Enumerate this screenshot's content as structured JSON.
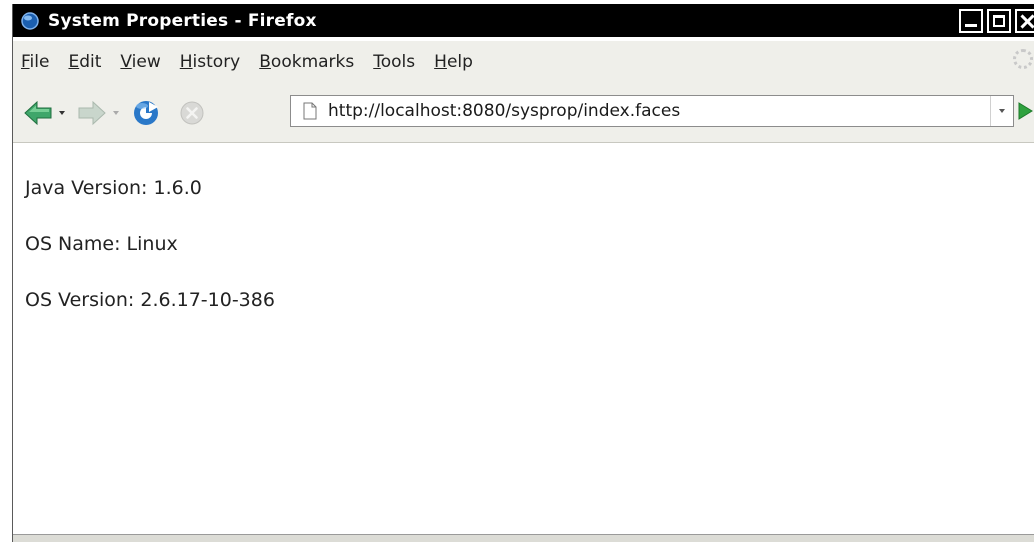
{
  "window": {
    "title": "System Properties - Firefox"
  },
  "menubar": {
    "items": [
      {
        "label": "File"
      },
      {
        "label": "Edit"
      },
      {
        "label": "View"
      },
      {
        "label": "History"
      },
      {
        "label": "Bookmarks"
      },
      {
        "label": "Tools"
      },
      {
        "label": "Help"
      }
    ]
  },
  "navbar": {
    "url": "http://localhost:8080/sysprop/index.faces",
    "icons": {
      "back": "back-arrow-icon",
      "forward": "forward-arrow-icon",
      "reload": "reload-icon",
      "stop": "stop-icon",
      "page": "page-icon",
      "go": "go-arrow-icon"
    }
  },
  "content": {
    "lines": [
      {
        "text": "Java Version: 1.6.0"
      },
      {
        "text": "OS Name: Linux"
      },
      {
        "text": "OS Version: 2.6.17-10-386"
      }
    ]
  },
  "colors": {
    "titlebar": "#000000",
    "chrome": "#efefea",
    "back_arrow": "#3fa66a",
    "go_arrow": "#2fa23f",
    "reload": "#2a78c8"
  }
}
